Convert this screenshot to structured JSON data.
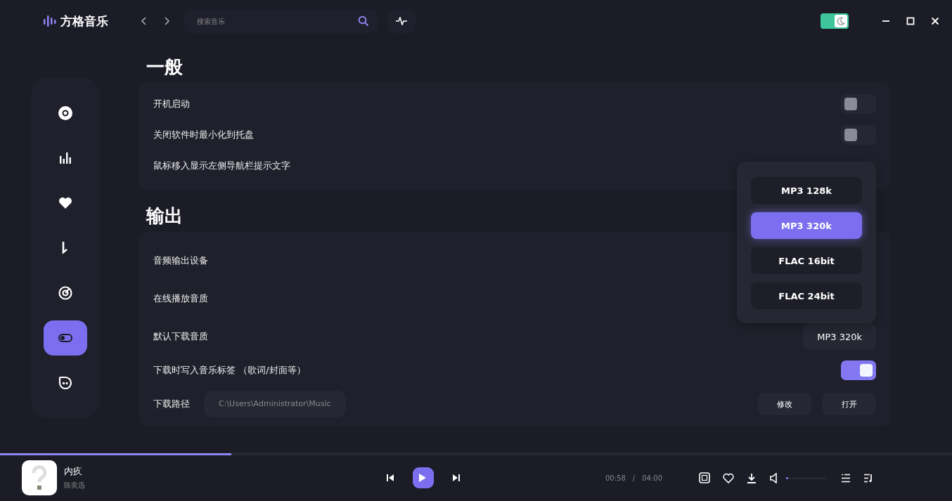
{
  "app": {
    "name": "方格音乐"
  },
  "search": {
    "placeholder": "搜索音乐"
  },
  "theme_toggle": {
    "on": true
  },
  "sidebar": {
    "items": [
      {
        "selected": false
      },
      {
        "selected": false
      },
      {
        "selected": false
      },
      {
        "selected": false
      },
      {
        "selected": false
      },
      {
        "selected": true
      },
      {
        "selected": false
      }
    ]
  },
  "sections": [
    {
      "title": "一般",
      "rows": [
        {
          "kind": "toggle",
          "label": "开机启动",
          "on": false
        },
        {
          "kind": "toggle",
          "label": "关闭软件时最小化到托盘",
          "on": false
        },
        {
          "kind": "label",
          "label": "鼠标移入显示左侧导航栏提示文字"
        }
      ]
    },
    {
      "title": "输出",
      "rows": [
        {
          "kind": "label",
          "label": "音频输出设备"
        },
        {
          "kind": "label",
          "label": "在线播放音质"
        },
        {
          "kind": "select",
          "label": "默认下载音质",
          "value": "MP3 320k"
        },
        {
          "kind": "toggle",
          "label": "下载时写入音乐标签 （歌词/封面等）",
          "on": true
        },
        {
          "kind": "path",
          "label": "下载路径",
          "value": "C:\\Users\\Administrator\\Music",
          "buttons": [
            "修改",
            "打开"
          ]
        }
      ]
    }
  ],
  "dropdown": {
    "options": [
      {
        "label": "MP3 128k",
        "selected": false
      },
      {
        "label": "MP3 320k",
        "selected": true
      },
      {
        "label": "FLAC 16bit",
        "selected": false
      },
      {
        "label": "FLAC 24bit",
        "selected": false
      }
    ]
  },
  "player": {
    "title": "内疚",
    "artist": "陈奕迅",
    "progress": {
      "level": 0.243
    },
    "elapsed": "00:58",
    "separator": "/",
    "duration": "04:00",
    "volume": {
      "level": 0.05
    }
  }
}
